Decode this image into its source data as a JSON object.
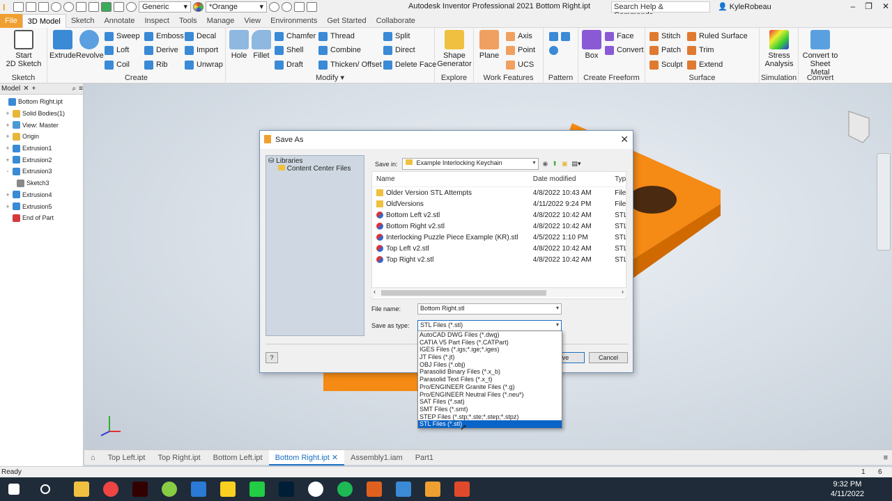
{
  "window": {
    "title": "Autodesk Inventor Professional 2021   Bottom Right.ipt",
    "search_placeholder": "Search Help & Commands...",
    "user": "KyleRobeau",
    "material": "Generic",
    "appearance": "*Orange"
  },
  "tabs": [
    {
      "label": "File"
    },
    {
      "label": "3D Model"
    },
    {
      "label": "Sketch"
    },
    {
      "label": "Annotate"
    },
    {
      "label": "Inspect"
    },
    {
      "label": "Tools"
    },
    {
      "label": "Manage"
    },
    {
      "label": "View"
    },
    {
      "label": "Environments"
    },
    {
      "label": "Get Started"
    },
    {
      "label": "Collaborate"
    }
  ],
  "ribbon": {
    "sketch": {
      "label": "Sketch",
      "start": "Start\n2D Sketch"
    },
    "create": {
      "label": "Create",
      "extrude": "Extrude",
      "revolve": "Revolve",
      "sweep": "Sweep",
      "loft": "Loft",
      "coil": "Coil",
      "emboss": "Emboss",
      "derive": "Derive",
      "rib": "Rib",
      "decal": "Decal",
      "import": "Import",
      "unwrap": "Unwrap"
    },
    "modify": {
      "label": "Modify",
      "hole": "Hole",
      "fillet": "Fillet",
      "chamfer": "Chamfer",
      "shell": "Shell",
      "draft": "Draft",
      "thread": "Thread",
      "combine": "Combine",
      "thicken": "Thicken/ Offset",
      "split": "Split",
      "direct": "Direct",
      "delete_face": "Delete Face"
    },
    "explore": {
      "label": "Explore",
      "shape_generator": "Shape\nGenerator"
    },
    "work_features": {
      "label": "Work Features",
      "plane": "Plane",
      "axis": "Axis",
      "point": "Point",
      "ucs": "UCS"
    },
    "pattern": {
      "label": "Pattern"
    },
    "freeform": {
      "label": "Create Freeform",
      "box": "Box",
      "face": "Face",
      "convert": "Convert"
    },
    "surface": {
      "label": "Surface",
      "stitch": "Stitch",
      "patch": "Patch",
      "sculpt": "Sculpt",
      "ruled": "Ruled Surface",
      "trim": "Trim",
      "extend": "Extend"
    },
    "simulation": {
      "label": "Simulation",
      "stress": "Stress\nAnalysis"
    },
    "convert": {
      "label": "Convert",
      "sheet_metal": "Convert to\nSheet Metal"
    }
  },
  "browser": {
    "tab": "Model",
    "items": [
      {
        "label": "Bottom Right.ipt",
        "color": "#3a8ad6"
      },
      {
        "label": "Solid Bodies(1)",
        "color": "#e8b63a"
      },
      {
        "label": "View: Master",
        "color": "#4a9ad6"
      },
      {
        "label": "Origin",
        "color": "#e8b63a"
      },
      {
        "label": "Extrusion1",
        "color": "#3a8ad6"
      },
      {
        "label": "Extrusion2",
        "color": "#3a8ad6"
      },
      {
        "label": "Extrusion3",
        "color": "#3a8ad6"
      },
      {
        "label": "Sketch3",
        "color": "#888888"
      },
      {
        "label": "Extrusion4",
        "color": "#3a8ad6"
      },
      {
        "label": "Extrusion5",
        "color": "#3a8ad6"
      },
      {
        "label": "End of Part",
        "color": "#d43a3a"
      }
    ]
  },
  "doc_tabs": [
    {
      "label": "Top Left.ipt"
    },
    {
      "label": "Top Right.ipt"
    },
    {
      "label": "Bottom Left.ipt"
    },
    {
      "label": "Bottom Right.ipt"
    },
    {
      "label": "Assembly1.iam"
    },
    {
      "label": "Part1"
    }
  ],
  "status": {
    "text": "Ready",
    "count1": "1",
    "count2": "6"
  },
  "taskbar": {
    "time": "9:32 PM",
    "date": "4/11/2022"
  },
  "dialog": {
    "title": "Save As",
    "libraries": "Libraries",
    "content_center": "Content Center Files",
    "save_in_label": "Save in:",
    "save_in_value": "Example Interlocking Keychain",
    "columns": {
      "name": "Name",
      "date": "Date modified",
      "type": "Typ"
    },
    "files": [
      {
        "name": "Older Version STL Attempts",
        "date": "4/8/2022 10:43 AM",
        "type": "File",
        "folder": true
      },
      {
        "name": "OldVersions",
        "date": "4/11/2022 9:24 PM",
        "type": "File",
        "folder": true
      },
      {
        "name": "Bottom Left v2.stl",
        "date": "4/8/2022 10:42 AM",
        "type": "STL",
        "folder": false
      },
      {
        "name": "Bottom Right v2.stl",
        "date": "4/8/2022 10:42 AM",
        "type": "STL",
        "folder": false
      },
      {
        "name": "Interlocking Puzzle Piece Example (KR).stl",
        "date": "4/5/2022 1:10 PM",
        "type": "STL",
        "folder": false
      },
      {
        "name": "Top Left v2.stl",
        "date": "4/8/2022 10:42 AM",
        "type": "STL",
        "folder": false
      },
      {
        "name": "Top Right v2.stl",
        "date": "4/8/2022 10:42 AM",
        "type": "STL",
        "folder": false
      }
    ],
    "file_name_label": "File name:",
    "file_name_value": "Bottom Right.stl",
    "save_type_label": "Save as type:",
    "save_type_value": "STL Files (*.stl)",
    "save_btn": "Save",
    "cancel_btn": "Cancel",
    "help_btn": "?",
    "type_options": [
      "AutoCAD DWG Files (*.dwg)",
      "CATIA V5 Part Files (*.CATPart)",
      "IGES Files (*.igs;*.ige;*.iges)",
      "JT Files (*.jt)",
      "OBJ Files (*.obj)",
      "Parasolid Binary Files (*.x_b)",
      "Parasolid Text Files (*.x_t)",
      "Pro/ENGINEER Granite Files (*.g)",
      "Pro/ENGINEER Neutral Files (*.neu*)",
      "SAT Files (*.sat)",
      "SMT Files (*.smt)",
      "STEP Files (*.stp;*.ste;*.step;*.stpz)",
      "STL Files (*.stl)"
    ]
  },
  "colors": {
    "accent": "#f0a030",
    "part": "#f58a14",
    "selection": "#0a64c8"
  }
}
